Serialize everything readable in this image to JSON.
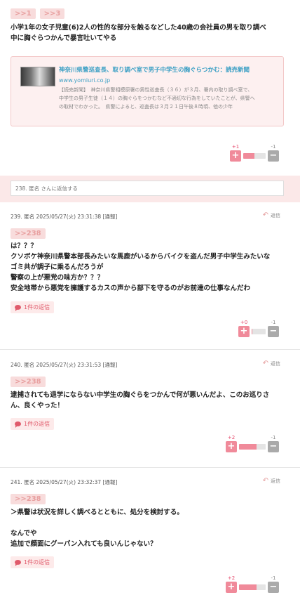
{
  "top_post": {
    "anchors": [
      ">>1",
      ">>3"
    ],
    "text_lines": [
      "小学1年の女子児童(6)2人の性的な部分を触るなどした40歳の会社員の男を取り調べ",
      "中に胸ぐらつかんで暴言吐いてやる"
    ],
    "link_card": {
      "title": "神奈川県警巡査長、取り調べ室で男子中学生の胸ぐらつかむ：読売新聞",
      "domain": "www.yomiuri.co.jp",
      "excerpt_lines": [
        "【読売新聞】　神奈川県警相模原署の男性巡査長（３６）が３月、署内の取り調べ室で、",
        "中学生の男子生徒（１４）の胸ぐらをつかむなど不適切な行為をしていたことが、県警へ",
        "の取材でわかった。　県警によると、巡査長は３月２１日午後８時頃、他の少年"
      ]
    },
    "vote": {
      "plus": "+1",
      "minus": "-1",
      "ratio": 0.5
    }
  },
  "reply_input": {
    "placeholder": "238. 匿名 さんに返信する"
  },
  "colors": {
    "accent": "#f08a9a",
    "link_blue": "#3a9fc4"
  },
  "comments": [
    {
      "meta": "239. 匿名 2025/05/27(火) 23:31:38 [通報]",
      "reply_label": "返信",
      "anchor": ">>238",
      "lines": [
        "は？？？",
        "クソボケ神奈川県警本部長みたいな馬鹿がいるからバイクを盗んだ男子中学生みたいな",
        "ゴミ共が調子に乗るんだろうが",
        "警察の上が悪党の味方か？？？",
        "安全地帯から悪党を擁護するカスの声から部下を守るのがお前達の仕事なんだわ"
      ],
      "reply_count": "1件の返信",
      "vote": {
        "plus": "+0",
        "minus": "-1",
        "ratio": 0.06
      }
    },
    {
      "meta": "240. 匿名 2025/05/27(火) 23:31:53 [通報]",
      "reply_label": "返信",
      "anchor": ">>238",
      "lines": [
        "逮捕されても退学にならない中学生の胸ぐらをつかんで何が悪いんだよ、このお巡りさ",
        "ん、良くやった！"
      ],
      "reply_count": "1件の返信",
      "vote": {
        "plus": "+2",
        "minus": "-1",
        "ratio": 0.67
      }
    },
    {
      "meta": "241. 匿名 2025/05/27(火) 23:32:37 [通報]",
      "reply_label": "返信",
      "anchor": ">>238",
      "lines": [
        "＞県警は状況を詳しく調べるとともに、処分を検討する。",
        "",
        "なんでや",
        "追加で顔面にグーパン入れても良いんじゃない？"
      ],
      "reply_count": "1件の返信",
      "vote": {
        "plus": "+2",
        "minus": "-1",
        "ratio": 0.67
      }
    }
  ]
}
